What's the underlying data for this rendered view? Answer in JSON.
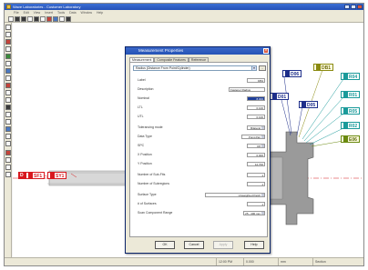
{
  "app": {
    "title": "Wave Laboratories - Customer Laboratory",
    "menus": [
      "File",
      "Edit",
      "View",
      "Insert",
      "Tools",
      "Data",
      "Window",
      "Help"
    ]
  },
  "canvas_labels": {
    "sf1": "SF1",
    "sy1": "SY1",
    "d06": "D06",
    "d01": "D01",
    "d05": "D05",
    "db1": "DB1",
    "r04": "R04",
    "r01": "R01",
    "r05": "R05",
    "r02": "R02",
    "e06": "E06",
    "left_marker": "D"
  },
  "dialog": {
    "title": "Measurement Properties",
    "close_glyph": "×",
    "tabs": [
      "Measurement",
      "Composite Features",
      "Reference"
    ],
    "type_combo": "Radius (Distance From Point/Cylinder)",
    "more_button": "...",
    "rows": [
      {
        "label": "Label",
        "value": "DB4"
      },
      {
        "label": "Description",
        "value": "Fastener Radius"
      },
      {
        "label": "Nominal",
        "value": "8.000"
      },
      {
        "label": "LTL",
        "value": "0.100"
      },
      {
        "label": "UTL",
        "value": "0.100"
      },
      {
        "label": "Tolerancing mode",
        "value": "Bilateral"
      },
      {
        "label": "Data Type",
        "value": "Point-Pair"
      },
      {
        "label": "SPC",
        "value": "Off"
      },
      {
        "label": "X Position",
        "value": "0.000"
      },
      {
        "label": "Y Position",
        "value": "12.700"
      },
      {
        "label": "Number of Sub-Fits",
        "value": "1"
      },
      {
        "label": "Number of Subregions",
        "value": "1"
      },
      {
        "label": "Surface Type",
        "value": "Unweighted Patch"
      },
      {
        "label": "# of Surfaces",
        "value": "1"
      },
      {
        "label": "Scan Component Range",
        "value": "25 - 400 mm"
      }
    ],
    "buttons": {
      "ok": "OK",
      "cancel": "Cancel",
      "apply": "Apply",
      "help": "Help"
    }
  },
  "status": {
    "cell1": "12:00 PM",
    "cell2": "0.000",
    "cell3": "mm",
    "cell4": "Section"
  },
  "colors": {
    "red": "#d8181e",
    "teal": "#1a9a9a",
    "navy": "#1d2e8a",
    "olive": "#8a8a10",
    "part": "#9a9a9a"
  }
}
